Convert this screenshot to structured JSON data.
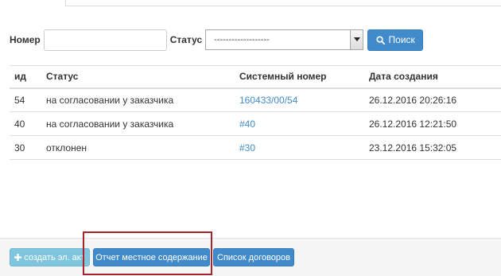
{
  "filter": {
    "number_label": "Номер",
    "number_value": "",
    "status_label": "Статус",
    "status_selected": "-------------------",
    "search_label": "Поиск"
  },
  "table": {
    "headers": [
      "ид",
      "Статус",
      "Системный номер",
      "Дата создания"
    ],
    "rows": [
      {
        "id": "54",
        "status": "на согласовании у заказчика",
        "system_number": "160433/00/54",
        "created": "26.12.2016 20:26:16"
      },
      {
        "id": "40",
        "status": "на согласовании у заказчика",
        "system_number": "#40",
        "created": "26.12.2016 12:21:50"
      },
      {
        "id": "30",
        "status": "отклонен",
        "system_number": "#30",
        "created": "23.12.2016 15:32:05"
      }
    ]
  },
  "footer": {
    "create_label": "создать эл. акт",
    "report_label": "Отчет местное содержание",
    "contracts_label": "Список договоров"
  },
  "colors": {
    "primary": "#428bca",
    "info_light": "#7fc5de",
    "highlight": "#a8242a"
  },
  "icons": {
    "search": "magnifier-icon",
    "create": "plus-icon",
    "dropdown": "chevron-down-icon"
  }
}
